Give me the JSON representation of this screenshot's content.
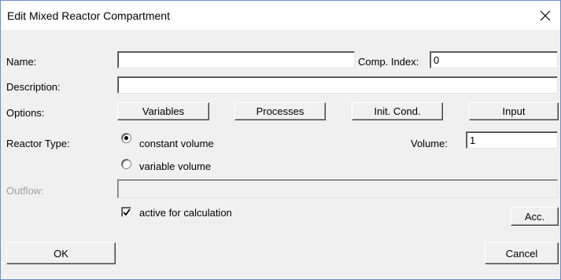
{
  "window": {
    "title": "Edit Mixed Reactor Compartment",
    "close_icon": "close-icon"
  },
  "name": {
    "label": "Name:",
    "value": ""
  },
  "comp_index": {
    "label": "Comp. Index:",
    "value": "0"
  },
  "description": {
    "label": "Description:",
    "value": ""
  },
  "options": {
    "label": "Options:",
    "buttons": [
      "Variables",
      "Processes",
      "Init. Cond.",
      "Input"
    ]
  },
  "reactor_type": {
    "label": "Reactor Type:",
    "options": [
      "constant volume",
      "variable volume"
    ],
    "selected": "constant volume"
  },
  "volume": {
    "label": "Volume:",
    "value": "1"
  },
  "outflow": {
    "label": "Outflow:",
    "value": "",
    "enabled": false
  },
  "active": {
    "label": "active for calculation",
    "checked": true
  },
  "acc_button": "Acc.",
  "footer": {
    "ok_label": "OK",
    "cancel_label": "Cancel"
  }
}
